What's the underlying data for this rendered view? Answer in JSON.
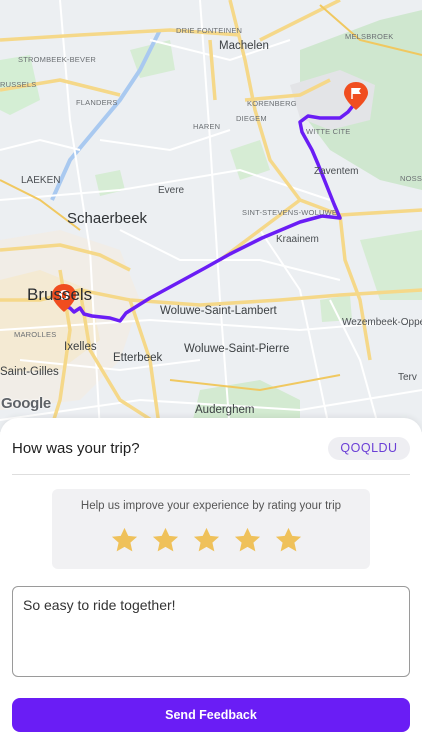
{
  "map": {
    "labels": {
      "drie_fonteinen": "DRIE FONTEINEN",
      "machelen": "Machelen",
      "melsbroek": "MELSBROEK",
      "strombeek": "STROMBEEK-BEVER",
      "russels": "RUSSELS",
      "flanders": "FLANDERS",
      "korenberg": "KORENBERG",
      "diegem": "DIEGEM",
      "haren": "HAREN",
      "witte_cite": "WITTE CITE",
      "laeken": "LAEKEN",
      "evere": "Evere",
      "zaventem": "Zaventem",
      "nossegem": "NOSSE",
      "schaerbeek": "Schaerbeek",
      "sint_stevens": "SINT-STEVENS-WOLUWE",
      "kraainem": "Kraainem",
      "brussels": "Brussels",
      "woluwe_sl": "Woluwe-Saint-Lambert",
      "wezembeek": "Wezembeek-Oppe",
      "marolles": "MAROLLES",
      "ixelles": "Ixelles",
      "etterbeek": "Etterbeek",
      "woluwe_sp": "Woluwe-Saint-Pierre",
      "saint_gilles": "Saint-Gilles",
      "terv": "Terv",
      "auderghem": "Auderghem"
    },
    "attribution": "Google",
    "route_color": "#6a1df5",
    "marker_color": "#f04d1f"
  },
  "feedback": {
    "question": "How was your trip?",
    "trip_code": "QOQLDU",
    "rating_prompt": "Help us improve your experience by rating your trip",
    "rating": 5,
    "rating_max": 5,
    "star_color": "#efc15a",
    "comment_value": "So easy to ride together!",
    "send_label": "Send Feedback",
    "accent_color": "#6a1df5"
  }
}
